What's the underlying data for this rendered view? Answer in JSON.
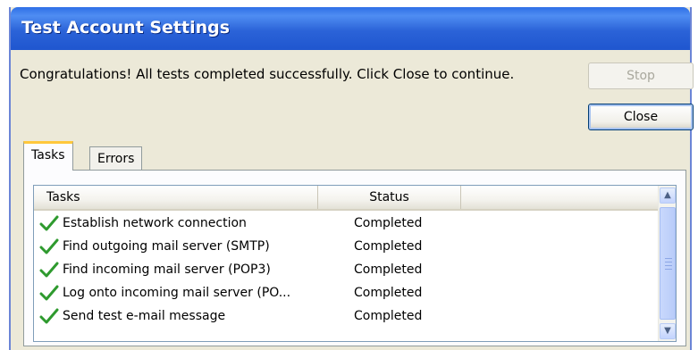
{
  "window": {
    "title": "Test Account Settings"
  },
  "message": "Congratulations! All tests completed successfully. Click Close to continue.",
  "buttons": {
    "stop": "Stop",
    "close": "Close"
  },
  "tabs": [
    {
      "label": "Tasks",
      "active": true
    },
    {
      "label": "Errors",
      "active": false
    }
  ],
  "list": {
    "columns": {
      "tasks": "Tasks",
      "status": "Status"
    },
    "rows": [
      {
        "icon": "checkmark-icon",
        "task": "Establish network connection",
        "status": "Completed"
      },
      {
        "icon": "checkmark-icon",
        "task": "Find outgoing mail server (SMTP)",
        "status": "Completed"
      },
      {
        "icon": "checkmark-icon",
        "task": "Find incoming mail server (POP3)",
        "status": "Completed"
      },
      {
        "icon": "checkmark-icon",
        "task": "Log onto incoming mail server (PO...",
        "status": "Completed"
      },
      {
        "icon": "checkmark-icon",
        "task": "Send test e-mail message",
        "status": "Completed"
      }
    ]
  },
  "colors": {
    "titlebar": "#2b63d8",
    "check": "#2e9a2e",
    "tab_highlight": "#ffc83c"
  }
}
